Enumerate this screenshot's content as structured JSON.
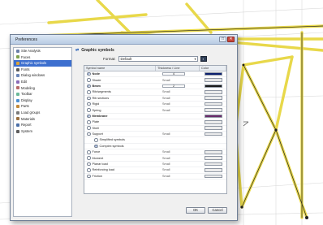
{
  "dialog": {
    "title": "Preferences",
    "close_glyph": "✕",
    "maximize_glyph": "□"
  },
  "sidebar": {
    "items": [
      {
        "label": "Site Analysis",
        "icon": "folder-icon",
        "color": "#6b7fa8"
      },
      {
        "label": "Faces",
        "icon": "faces-icon",
        "color": "#7fa24d"
      },
      {
        "label": "Graphic symbols",
        "icon": "graphic-symbols-icon",
        "color": "#d9a33a",
        "active": true
      },
      {
        "label": "Fonts",
        "icon": "fonts-icon",
        "color": "#5a5a5a"
      },
      {
        "label": "Dialog windows",
        "icon": "dialog-icon",
        "color": "#6b86b8"
      },
      {
        "label": "Edit",
        "icon": "edit-icon",
        "color": "#8a6bb8"
      },
      {
        "label": "Modeling",
        "icon": "modeling-icon",
        "color": "#b86b6b"
      },
      {
        "label": "Toolbar",
        "icon": "toolbar-icon",
        "color": "#6bb89a"
      },
      {
        "label": "Display",
        "icon": "display-icon",
        "color": "#4d8fd1"
      },
      {
        "label": "Parts",
        "icon": "parts-icon",
        "color": "#c48a3a"
      },
      {
        "label": "Load groups",
        "icon": "load-groups-icon",
        "color": "#7a7a7a"
      },
      {
        "label": "Materials",
        "icon": "materials-icon",
        "color": "#9a7040"
      },
      {
        "label": "Report",
        "icon": "report-icon",
        "color": "#4a6fa8"
      },
      {
        "label": "System",
        "icon": "system-icon",
        "color": "#5e5e5e"
      }
    ]
  },
  "panel": {
    "title_arrow": "⇄",
    "title": "Graphic symbols",
    "format_label": "Format:",
    "format_value": "Default",
    "format_chevron": "▾",
    "save_glyph": "▪"
  },
  "table": {
    "headers": [
      "Symbol name",
      "Thickness / Line",
      "Color"
    ],
    "rows": [
      {
        "name": "Node",
        "check": "✓",
        "checked": true,
        "lt": "4",
        "lt_box": true,
        "color": "#0b1f6e"
      },
      {
        "name": "Shade",
        "check": "",
        "checked": false,
        "lt": "Small",
        "lt_box": false,
        "color": "#e6e6e6"
      },
      {
        "name": "Beam",
        "check": "✓",
        "checked": true,
        "lt": "2",
        "lt_box": true,
        "color": "#1a1a1a"
      },
      {
        "name": "Rib/segments",
        "check": "",
        "checked": false,
        "lt": "Small",
        "lt_box": false,
        "color": "#ececec"
      },
      {
        "name": "Rib sections",
        "check": "",
        "checked": false,
        "lt": "Small",
        "lt_box": false,
        "color": "#ececec"
      },
      {
        "name": "Rigid",
        "check": "",
        "checked": false,
        "lt": "Small",
        "lt_box": false,
        "color": "#ececec"
      },
      {
        "name": "Spring",
        "check": "",
        "checked": false,
        "lt": "Small",
        "lt_box": false,
        "color": "#ececec"
      },
      {
        "name": "Membrane",
        "check": "✓",
        "checked": true,
        "lt": "",
        "lt_box": false,
        "color": "#6a2a6a"
      },
      {
        "name": "Plate",
        "check": "",
        "checked": false,
        "lt": "",
        "lt_box": false,
        "color": "#ececec"
      },
      {
        "name": "Shell",
        "check": "",
        "checked": false,
        "lt": "",
        "lt_box": false,
        "color": "#ececec"
      },
      {
        "name": "Support",
        "check": "",
        "checked": false,
        "lt": "Small",
        "lt_box": false,
        "color": "#ececec"
      },
      {
        "name": "Simplified symbols",
        "check": "",
        "checked": false,
        "sub": true,
        "lt": "",
        "lt_box": false,
        "color": ""
      },
      {
        "name": "Complex symbols",
        "check": "●",
        "checked": false,
        "sub": true,
        "lt": "",
        "lt_box": false,
        "color": ""
      },
      {
        "name": "Force",
        "check": "",
        "checked": false,
        "lt": "Small",
        "lt_box": false,
        "color": "#ececec"
      },
      {
        "name": "Moment",
        "check": "",
        "checked": false,
        "lt": "Small",
        "lt_box": false,
        "color": "#ececec"
      },
      {
        "name": "Planar load",
        "check": "",
        "checked": false,
        "lt": "Small",
        "lt_box": false,
        "color": "#ececec"
      },
      {
        "name": "Reinforcing load",
        "check": "",
        "checked": false,
        "lt": "Small",
        "lt_box": false,
        "color": "#ececec"
      },
      {
        "name": "Friction",
        "check": "",
        "checked": false,
        "lt": "Small",
        "lt_box": false,
        "color": "#ececec"
      }
    ]
  },
  "footer": {
    "ok_label": "OK",
    "cancel_label": "Cancel"
  }
}
